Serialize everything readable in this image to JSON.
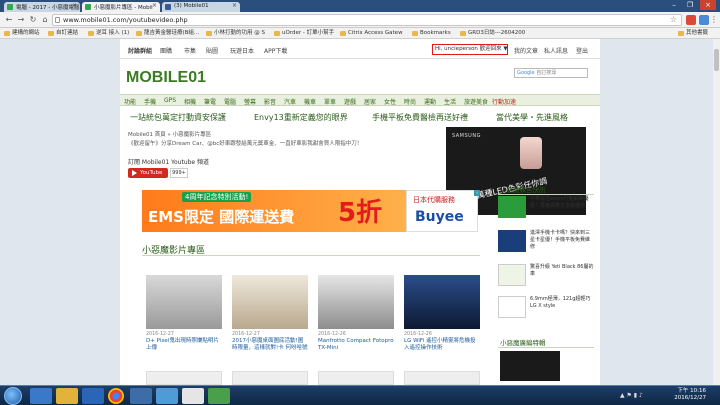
{
  "browser": {
    "tabs": [
      {
        "label": "電腦 - 2017 - 小惡魔電腦",
        "active": false,
        "fav_color": "#2fa84f"
      },
      {
        "label": "小惡魔影片專區 - Mobil",
        "active": true,
        "fav_color": "#2fa84f"
      },
      {
        "label": "(3) Mobile01",
        "active": false,
        "fav_color": "#3b5998"
      }
    ],
    "url": "www.mobile01.com/youtubevideo.php",
    "bookmarks": [
      "建構的網站",
      "自訂連結",
      "逆耳 接入 (1)",
      "龍吉黃金醫珪療(B組...",
      "小林打勤的功用 @ S",
      "uOrder - 訂單小幫手",
      "Citrix Access Gatew",
      "Bookmarks",
      "GRD3日誌---2604200",
      "其他書籤"
    ]
  },
  "site": {
    "topnav": [
      "討論群組",
      "團購",
      "市集",
      "貼圖",
      "玩遊日本",
      "APP下載"
    ],
    "user_greeting": "Hi, uncleperson 歡迎回來 ▼",
    "user_links": [
      "我的文章",
      "私人訊息",
      "登出"
    ],
    "logo_text": "MOBILE01",
    "search_placeholder": "自訂搜尋",
    "categories": [
      "功能",
      "手機",
      "GPS",
      "相機",
      "筆電",
      "電腦",
      "螢幕",
      "影音",
      "汽車",
      "機車",
      "單車",
      "遊戲",
      "居家",
      "女性",
      "時尚",
      "運動",
      "生活",
      "旅遊美食",
      "行動加速"
    ],
    "promos": [
      "一站統包萬定打動資安保護",
      "Envy13重新定義您的眼界",
      "手機平板免費醫檢再送好禮",
      "當代美學・先進風格"
    ],
    "breadcrumb": "Mobile01 首頁 » 小惡魔影片專區",
    "intro": "《歡迎留午》分享Dream Car、@bc好車跟發給萬元獎車金、一直好車影我甜會買人限指中刀！",
    "subscribe_label": "訂閱 Mobile01 Youtube 頻道",
    "youtube_label": "YouTube",
    "youtube_count": "999+",
    "samsung_ad": {
      "brand": "SAMSUNG",
      "caption": "1600萬種LED色彩任你調"
    },
    "banner_ad": {
      "tag": "4周年記念特別活動!",
      "headline": "EMS限定 國際運送費",
      "discount": "5折",
      "sub1": "日本代購服務",
      "sub2": "Buyee"
    },
    "section_title": "小惡魔影片專區",
    "videos": [
      {
        "date": "2016-12-27",
        "title": "D+ Pixel鬼出現時照嫌貼明片上傳"
      },
      {
        "date": "2016-12-27",
        "title": "2017小惡魔桌面圖底活動!圖時限量，這樣就對!卡 何吩哈號"
      },
      {
        "date": "2016-12-26",
        "title": "Manfrotto Compact Fotopro TX-Mini"
      },
      {
        "date": "2016-12-26",
        "title": "LG WiFi 遙控小精靈將危機投入遙控操作技術"
      }
    ],
    "sidebar": {
      "ads_title": "小惡魔廣告快訊",
      "ads": [
        {
          "label": "中華電信zoom行動網路優惠！再會員雙方享受優惠",
          "color": "#2b9c3b"
        },
        {
          "label": "進澤手機卡卡嗎？快來到三星卡星優！手機平板免費維修",
          "color": "#1a3e7a"
        },
        {
          "label": "驚喜升級 Yeti Black 86屬的車",
          "color": "#eef5e6"
        },
        {
          "label": "6.9mm極薄，121g超輕巧 LG X style",
          "color": "#ffffff"
        }
      ],
      "ads2_title": "小惡魔廣編特輯"
    }
  },
  "taskbar": {
    "time": "下午 10:16",
    "date": "2016/12/27"
  }
}
